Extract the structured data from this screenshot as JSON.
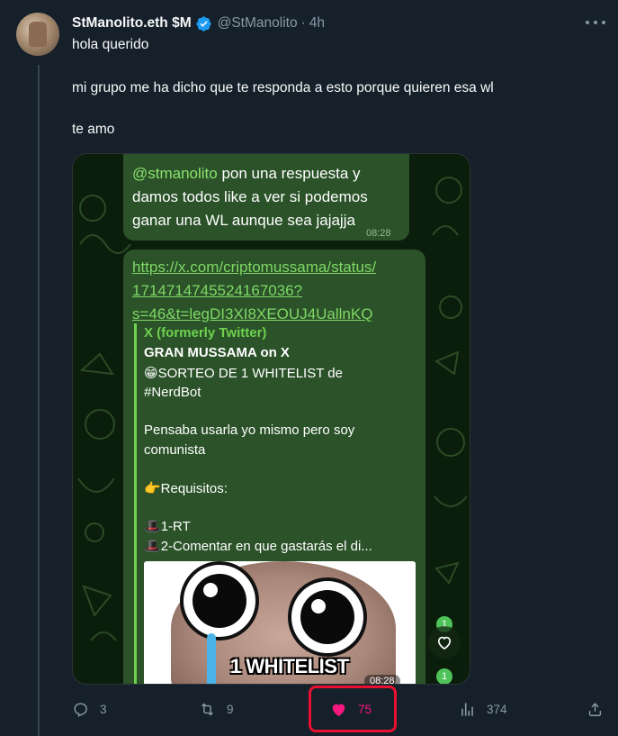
{
  "tweet": {
    "display_name": "StManolito.eth $M",
    "verified": true,
    "handle": "@StManolito",
    "separator": "·",
    "time": "4h",
    "lines": [
      "hola querido",
      "mi grupo me ha dicho que te responda a esto porque quieren esa wl",
      "te amo"
    ]
  },
  "media": {
    "message1": {
      "mention": "@stmanolito",
      "line1_rest": " pon una respuesta y",
      "line2": "damos todos like a ver si podemos",
      "line3": "ganar una WL aunque sea jajajja",
      "time": "08:28"
    },
    "message2": {
      "link_lines": [
        "https://x.com/criptomussama/status/",
        "1714714745524167036?",
        "s=46&t=legDI3XI8XEOUJ4UallnKQ"
      ],
      "preview": {
        "source": "X (formerly Twitter)",
        "title": "GRAN MUSSAMA on X",
        "lines": [
          "😁SORTEO DE 1 WHITELIST de",
          "#NerdBot",
          "Pensaba usarla yo mismo pero soy",
          "comunista",
          "👉Requisitos:",
          "1-RT",
          "2-Comentar en que gastarás el di..."
        ]
      },
      "thumbnail_text": "1 WHITELIST",
      "time": "08:28"
    },
    "badges": [
      "1",
      "1"
    ]
  },
  "actions": {
    "replies": "3",
    "reposts": "9",
    "likes": "75",
    "views": "374"
  },
  "colors": {
    "background": "#15202b",
    "muted": "#8b98a5",
    "like": "#f91880",
    "verified": "#1d9bf0",
    "highlight": "#e8102f"
  }
}
